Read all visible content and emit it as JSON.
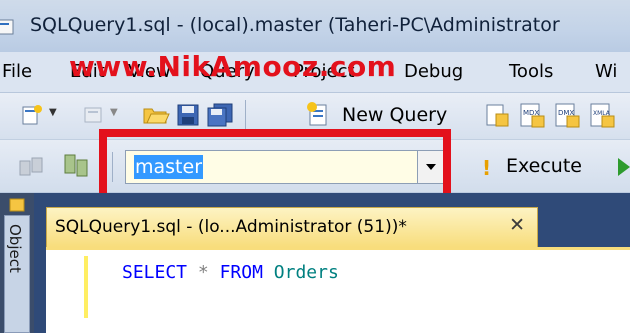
{
  "window": {
    "title": "SQLQuery1.sql - (local).master (Taheri-PC\\Administrator"
  },
  "watermark": "www.NikAmooz.com",
  "menu": {
    "items": [
      "File",
      "Edit",
      "View",
      "Query",
      "Project",
      "Debug",
      "Tools",
      "Wi"
    ]
  },
  "toolbar": {
    "new_query_label": "New Query",
    "execute_label": "Execute"
  },
  "database_selector": {
    "value": "master"
  },
  "object_explorer_tab": {
    "label": "Object"
  },
  "document_tab": {
    "label": "SQLQuery1.sql - (lo...Administrator (51))*",
    "close_glyph": "✕"
  },
  "editor": {
    "keyword_select": "SELECT",
    "operator_star": "*",
    "keyword_from": "FROM",
    "table_name": "Orders"
  },
  "colors": {
    "highlight": "#e3111c",
    "selection": "#3399ff",
    "active_tab": "#f8dd7c",
    "sql_keyword": "#0000ff",
    "sql_identifier": "#008080"
  }
}
